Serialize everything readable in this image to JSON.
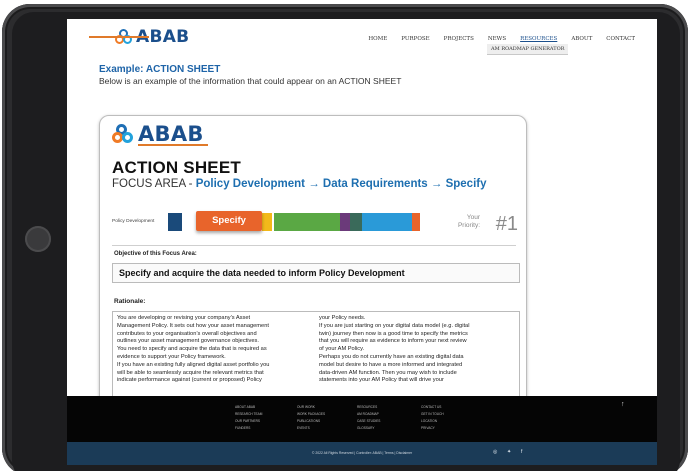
{
  "site": {
    "logo_text": "ABAB",
    "nav": [
      "HOME",
      "PURPOSE",
      "PROJECTS",
      "NEWS",
      "RESOURCES",
      "ABOUT",
      "CONTACT"
    ],
    "active_nav": "RESOURCES",
    "subnav": "AM ROADMAP GENERATOR"
  },
  "intro": {
    "title": "Example: ACTION SHEET",
    "description": "Below is an example of the information that could appear on an ACTION SHEET"
  },
  "sheet": {
    "logo_text": "ABAB",
    "title": "ACTION SHEET",
    "focus_prefix": "FOCUS AREA - ",
    "focus_value": "Policy Development → Data Requirements → Specify",
    "track_label": "Policy Development",
    "active_step": "Specify",
    "priority_label_1": "Your",
    "priority_label_2": "Priority:",
    "priority_value": "#1",
    "track_colors": [
      "#1a4a7a",
      "#f2b91a",
      "#5aa844",
      "#6b3a7a",
      "#3a6a5a",
      "#2a9ad8",
      "#e8642b"
    ],
    "objective_label": "Objective of this Focus Area:",
    "objective_text": "Specify and acquire the data needed to inform Policy Development",
    "rationale_label": "Rationale:",
    "rationale_col1": [
      "You are developing or revising your company’s Asset",
      "Management Policy.  It sets out how your asset management",
      "contributes to your organisation’s overall objectives and",
      "outlines your asset management governance objectives.",
      "You need to specify and acquire the data that is required as",
      "evidence to support your Policy framework.",
      "If you have an existing fully aligned digital asset portfolio you",
      "will be able to seamlessly acquire the relevant metrics that",
      "indicate performance against (current or proposed) Policy"
    ],
    "rationale_col2": [
      "your Policy needs.",
      "If you are just starting on your digital data model (e.g. digital",
      "twin) journey then now is a good time to specify the metrics",
      "that you will require as evidence to inform your next review",
      "of your AM Policy.",
      "Perhaps you do not currently have an existing digital data",
      "model but desire to have a more informed and integrated",
      "data-driven AM function.  Then you may wish to include",
      "statements into your AM Policy that will drive your"
    ]
  },
  "footer": {
    "columns": [
      [
        "ABOUT ABAB",
        "RESEARCH TEAM",
        "OUR PARTNERS",
        "FUNDERS"
      ],
      [
        "OUR WORK",
        "WORK PACKAGES",
        "PUBLICATIONS",
        "EVENTS"
      ],
      [
        "RESOURCES",
        "AM ROADMAP",
        "CASE STUDIES",
        "GLOSSARY"
      ],
      [
        "CONTACT US",
        "GET IN TOUCH",
        "LOCATION",
        "PRIVACY"
      ]
    ],
    "back_to_top": "↑",
    "copyright": "© 2022 All Rights Reserved | Controller: ABAB | Terms | Disclaimer",
    "social": [
      "◎",
      "✦",
      "f"
    ]
  }
}
